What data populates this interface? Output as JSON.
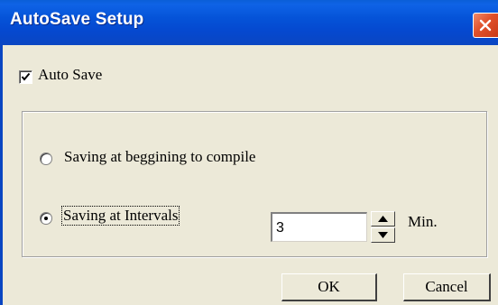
{
  "window": {
    "title": "AutoSave Setup"
  },
  "auto_save": {
    "label": "Auto Save",
    "checked": true
  },
  "options": {
    "radio1_label": "Saving at beggining to compile",
    "radio2_label": "Saving at Intervals",
    "selected": "Saving at Intervals"
  },
  "interval": {
    "value": "3",
    "unit": "Min."
  },
  "buttons": {
    "ok": "OK",
    "cancel": "Cancel"
  },
  "icons": {
    "close": "close-icon",
    "check": "checkmark-icon",
    "spin_up": "arrow-up-icon",
    "spin_down": "arrow-down-icon"
  },
  "colors": {
    "titlebar": "#0553d8",
    "close_button": "#e0502a",
    "dialog_bg": "#ece9d8"
  }
}
